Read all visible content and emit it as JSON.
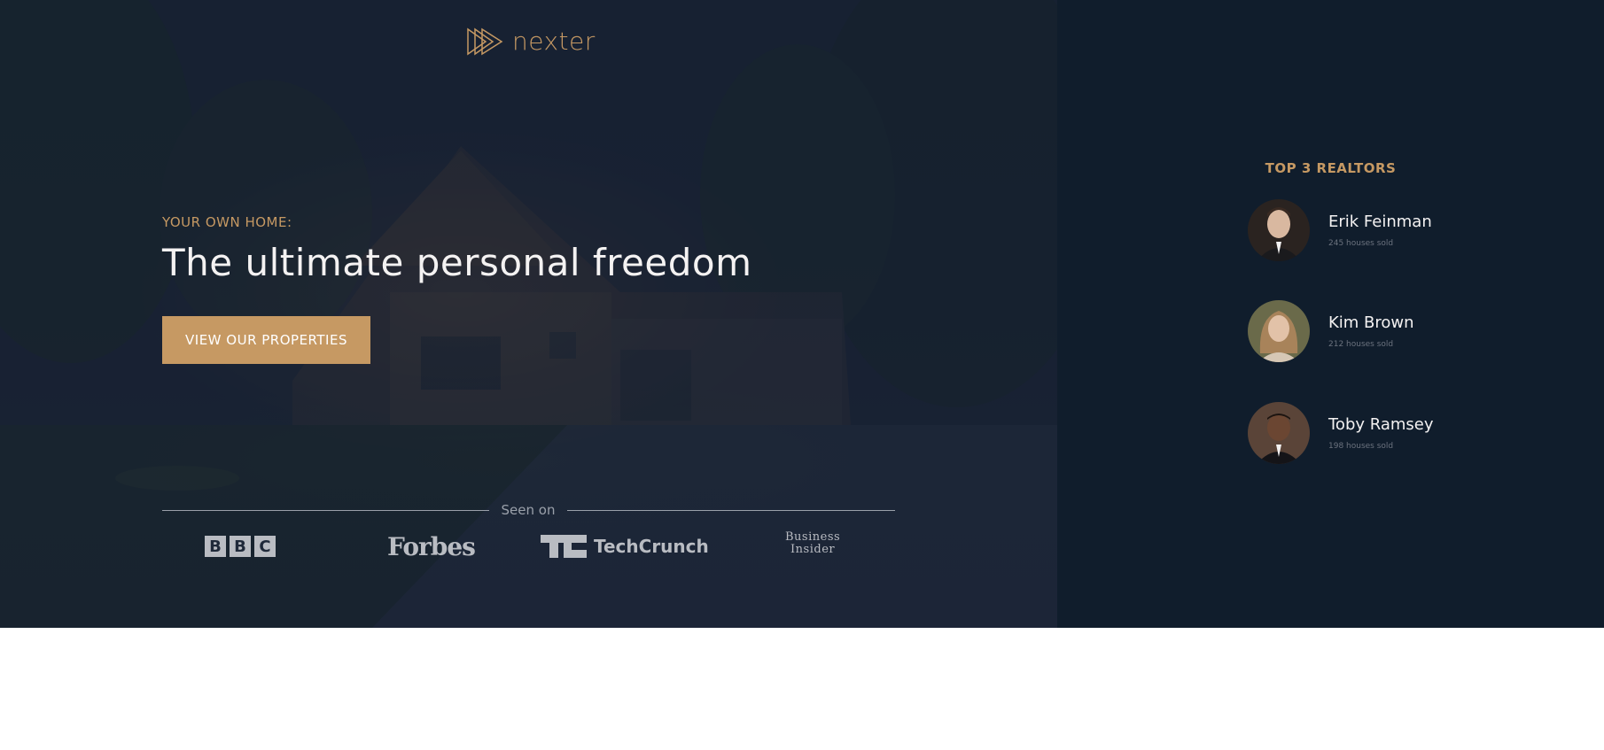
{
  "brand": {
    "name": "nexter",
    "accent_color": "#c69963",
    "dark_color": "#101d2c"
  },
  "hero": {
    "subtitle": "Your own home:",
    "title": "The ultimate personal freedom",
    "cta_label": "View our properties"
  },
  "seen_on": {
    "label": "Seen on",
    "logos": [
      {
        "name": "BBC",
        "icon": "bbc-logo",
        "letters": [
          "B",
          "B",
          "C"
        ]
      },
      {
        "name": "Forbes",
        "icon": "forbes-logo"
      },
      {
        "name": "TechCrunch",
        "icon": "techcrunch-logo"
      },
      {
        "name": "Business Insider",
        "icon": "business-insider-logo",
        "lines": [
          "Business",
          "Insider"
        ]
      }
    ]
  },
  "realtors": {
    "heading": "Top 3 Realtors",
    "items": [
      {
        "name": "Erik Feinman",
        "sold": "245 houses sold",
        "avatar": "avatar-photo"
      },
      {
        "name": "Kim Brown",
        "sold": "212 houses sold",
        "avatar": "avatar-photo"
      },
      {
        "name": "Toby Ramsey",
        "sold": "198 houses sold",
        "avatar": "avatar-photo"
      }
    ]
  }
}
